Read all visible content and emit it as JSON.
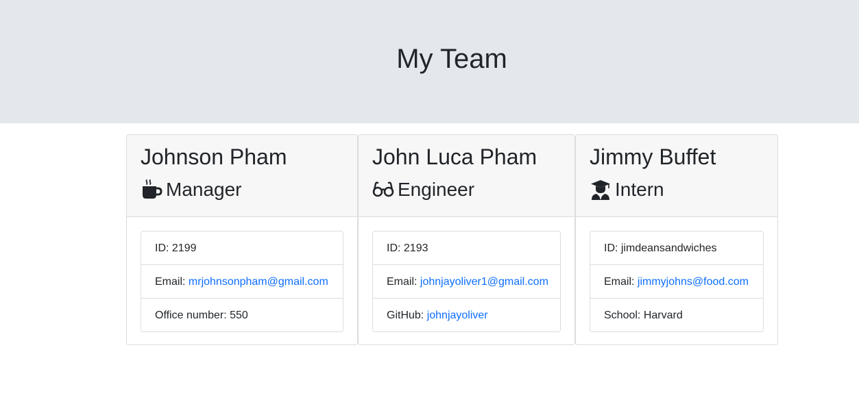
{
  "header": {
    "title": "My Team"
  },
  "cards": [
    {
      "name": "Johnson Pham",
      "role": "Manager",
      "icon": "coffee-mug-icon",
      "id_label": "ID: 2199",
      "email_prefix": "Email: ",
      "email": "mrjohnsonpham@gmail.com",
      "extra_prefix": "Office number: ",
      "extra_value": "550"
    },
    {
      "name": "John Luca Pham",
      "role": "Engineer",
      "icon": "glasses-icon",
      "id_label": "ID: 2193",
      "email_prefix": "Email: ",
      "email": "johnjayoliver1@gmail.com",
      "extra_prefix": "GitHub: ",
      "extra_value": "johnjayoliver"
    },
    {
      "name": "Jimmy Buffet",
      "role": "Intern",
      "icon": "graduate-icon",
      "id_label": "ID: jimdeansandwiches",
      "email_prefix": "Email: ",
      "email": "jimmyjohns@food.com",
      "extra_prefix": "School: ",
      "extra_value": "Harvard"
    }
  ],
  "colors": {
    "jumbotron_bg": "#e4e7eb",
    "card_header_bg": "#f7f7f7",
    "link": "#0d6efd"
  }
}
